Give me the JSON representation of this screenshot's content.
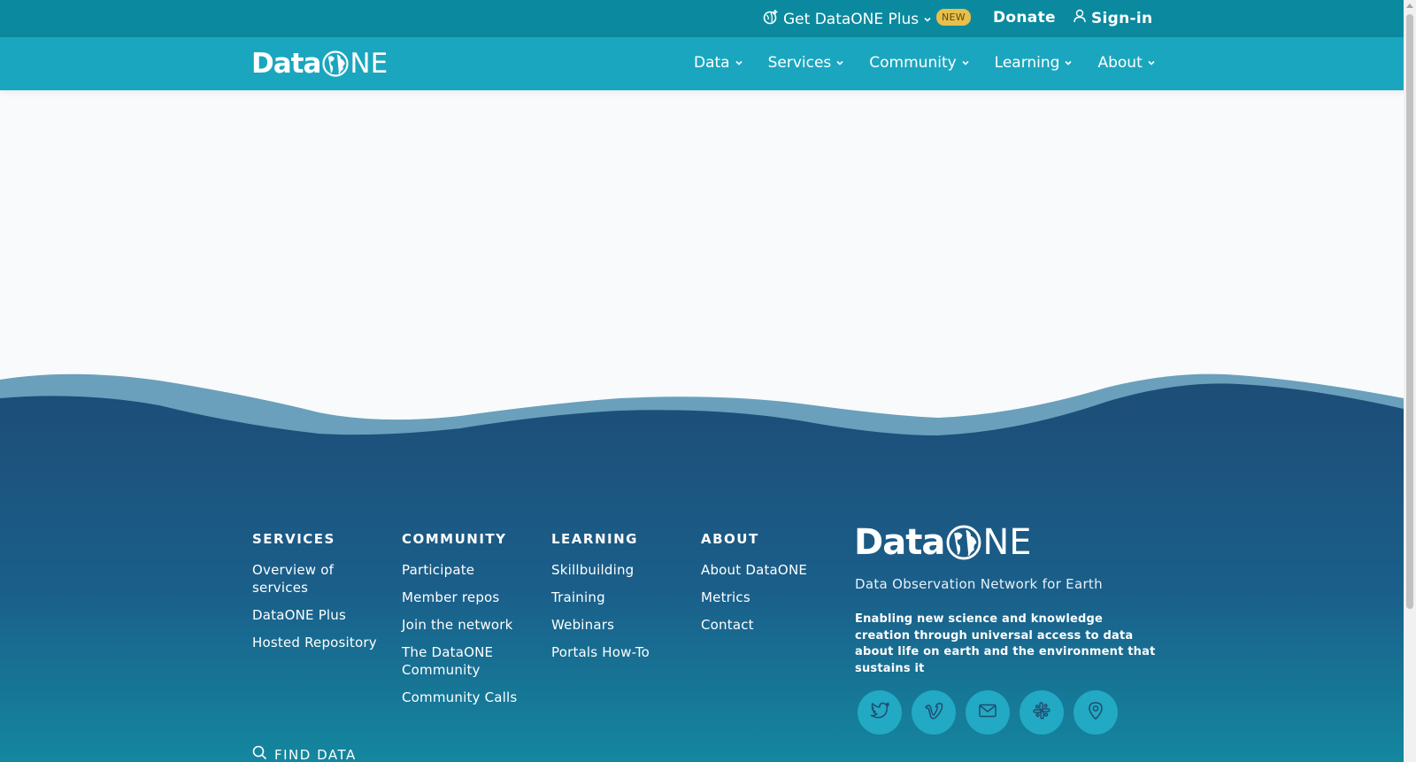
{
  "topbar": {
    "plus_label": "Get DataONE Plus",
    "new_badge": "NEW",
    "donate_label": "Donate",
    "signin_label": "Sign-in"
  },
  "brand": {
    "name_part1": "Data",
    "name_part2": "NE"
  },
  "nav": {
    "items": [
      {
        "label": "Data"
      },
      {
        "label": "Services"
      },
      {
        "label": "Community"
      },
      {
        "label": "Learning"
      },
      {
        "label": "About"
      }
    ]
  },
  "footer": {
    "columns": [
      {
        "heading": "SERVICES",
        "links": [
          "Overview of services",
          "DataONE Plus",
          "Hosted Repository"
        ]
      },
      {
        "heading": "COMMUNITY",
        "links": [
          "Participate",
          "Member repos",
          "Join the network",
          "The DataONE Community",
          "Community Calls"
        ]
      },
      {
        "heading": "LEARNING",
        "links": [
          "Skillbuilding",
          "Training",
          "Webinars",
          "Portals How-To"
        ]
      },
      {
        "heading": "ABOUT",
        "links": [
          "About DataONE",
          "Metrics",
          "Contact"
        ]
      }
    ],
    "tagline": "Data Observation Network for Earth",
    "mission": "Enabling new science and knowledge creation through universal access to data about life on earth and the environment that sustains it",
    "socials": [
      "twitter-icon",
      "vimeo-icon",
      "mail-icon",
      "slack-icon",
      "map-pin-icon"
    ],
    "find_data_label": "FIND DATA"
  },
  "colors": {
    "topbar": "#0b8a9f",
    "nav": "#1ba6bf",
    "footer_dark": "#1d4f78",
    "footer_light_wave": "#6aa0bb",
    "footer_teal": "#14819f",
    "badge": "#e7bf4c"
  }
}
